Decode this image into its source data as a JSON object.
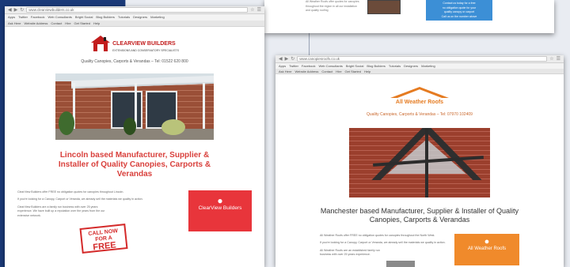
{
  "colors": {
    "background_blue": "#1b3a78",
    "clearview_red": "#e8353b",
    "allweather_orange": "#f08a2b",
    "info_blue": "#3c8fd6"
  },
  "window_left": {
    "url": "www.clearviewbuilders.co.uk",
    "bookmarks": [
      "Apps",
      "Twitter",
      "Facebook",
      "Web Consultants",
      "Bright Social",
      "Blog Builders",
      "Tutorials",
      "Designers",
      "Marketing"
    ],
    "toolbar": [
      "Ask Here",
      "Website Address",
      "Contact",
      "Hire",
      "Get Started",
      "Help"
    ],
    "logo_title": "CLEARVIEW BUILDERS",
    "logo_subtitle": "EXTENSIONS AND CONSERVATORY SPECIALISTS",
    "tagline": "Quality Canopies, Carports & Verandas – Tel: 01522 620 800",
    "heading": "Lincoln based Manufacturer, Supplier & Installer of Quality Canopies, Carports & Verandas",
    "body_lines": [
      "ClearView Builders offer FREE no obligation quotes for canopies throughout Lincoln.",
      "If you're looking for a Canopy, Carport or Veranda, we already sell the materials we quality in action.",
      "ClearView Builders are a family run business with over 25 years experience. We have built up a reputation over the years from the our extensive network."
    ],
    "sticker_line1": "CALL NOW FOR A",
    "sticker_line2": "FREE",
    "cta_icon": "person-icon",
    "cta_label": "ClearView Builders"
  },
  "window_top": {
    "text_lines": [
      "All Weather Roofs offer quotes for canopies",
      "throughout the region in all our installation",
      "and quality roofing"
    ],
    "box_lines": [
      "Contact us today for a free",
      "no obligation quote for your",
      "quality canopy or carport",
      "Call us on the number above"
    ]
  },
  "window_right": {
    "url": "www.canopiesroofs.co.uk",
    "bookmarks": [
      "Apps",
      "Twitter",
      "Facebook",
      "Web Consultants",
      "Bright Social",
      "Blog Builders",
      "Tutorials",
      "Designers",
      "Marketing"
    ],
    "toolbar": [
      "Ask Here",
      "Website Address",
      "Contact",
      "Hire",
      "Get Started",
      "Help"
    ],
    "logo_title": "All Weather Roofs",
    "tagline": "Quality Canopies, Carports & Verandas – Tel: 07970 102409",
    "heading": "Manchester based Manufacturer, Supplier & Installer of Quality Canopies, Carports & Verandas",
    "body_lines": [
      "All Weather Roofs offer FREE no obligation quotes for canopies throughout the North West.",
      "If you're looking for a Canopy, Carport or Veranda, we already sell the materials we quality in action.",
      "All Weather Roofs are an established family run business with over 25 years experience."
    ],
    "cta_icon": "person-icon",
    "cta_label": "All Weather Roofs"
  }
}
